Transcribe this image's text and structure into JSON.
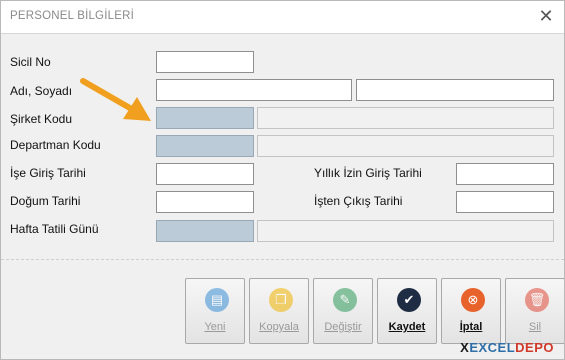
{
  "window": {
    "title": "PERSONEL BİLGİLERİ"
  },
  "labels": {
    "sicil_no": "Sicil No",
    "adi_soyadi": "Adı, Soyadı",
    "sirket_kodu": "Şirket Kodu",
    "departman_kodu": "Departman Kodu",
    "ise_giris_tarihi": "İşe Giriş Tarihi",
    "dogum_tarihi": "Doğum Tarihi",
    "hafta_tatili_gunu": "Hafta Tatili Günü",
    "yillik_izin_giris_tarihi": "Yıllık İzin Giriş Tarihi",
    "isten_cikis_tarihi": "İşten Çıkış Tarihi"
  },
  "fields": {
    "sicil_no": "",
    "adi": "",
    "soyadi": "",
    "sirket_kodu": "",
    "sirket_adi": "",
    "departman_kodu": "",
    "departman_adi": "",
    "ise_giris_tarihi": "",
    "dogum_tarihi": "",
    "hafta_tatili_gunu": "",
    "hafta_tatili_adi": "",
    "yillik_izin_giris_tarihi": "",
    "isten_cikis_tarihi": ""
  },
  "buttons": {
    "yeni": {
      "label": "Yeni",
      "icon": "document-icon",
      "color": "#3a8fd6",
      "enabled": false
    },
    "kopyala": {
      "label": "Kopyala",
      "icon": "copy-icon",
      "color": "#f0b400",
      "enabled": false
    },
    "degistir": {
      "label": "Değiştir",
      "icon": "edit-icon",
      "color": "#2e9a5a",
      "enabled": false
    },
    "kaydet": {
      "label": "Kaydet",
      "icon": "check-icon",
      "color": "#1f2d44",
      "enabled": true
    },
    "iptal": {
      "label": "İptal",
      "icon": "cancel-icon",
      "color": "#e8622c",
      "enabled": true
    },
    "sil": {
      "label": "Sil",
      "icon": "trash-icon",
      "color": "#e04a3a",
      "enabled": false
    }
  },
  "branding": {
    "logo_prefix": "X",
    "logo_excel": "EXCEL",
    "logo_depo": "DEPO"
  },
  "colors": {
    "accent_arrow": "#f0a01e",
    "code_field": "#bccbd8"
  }
}
